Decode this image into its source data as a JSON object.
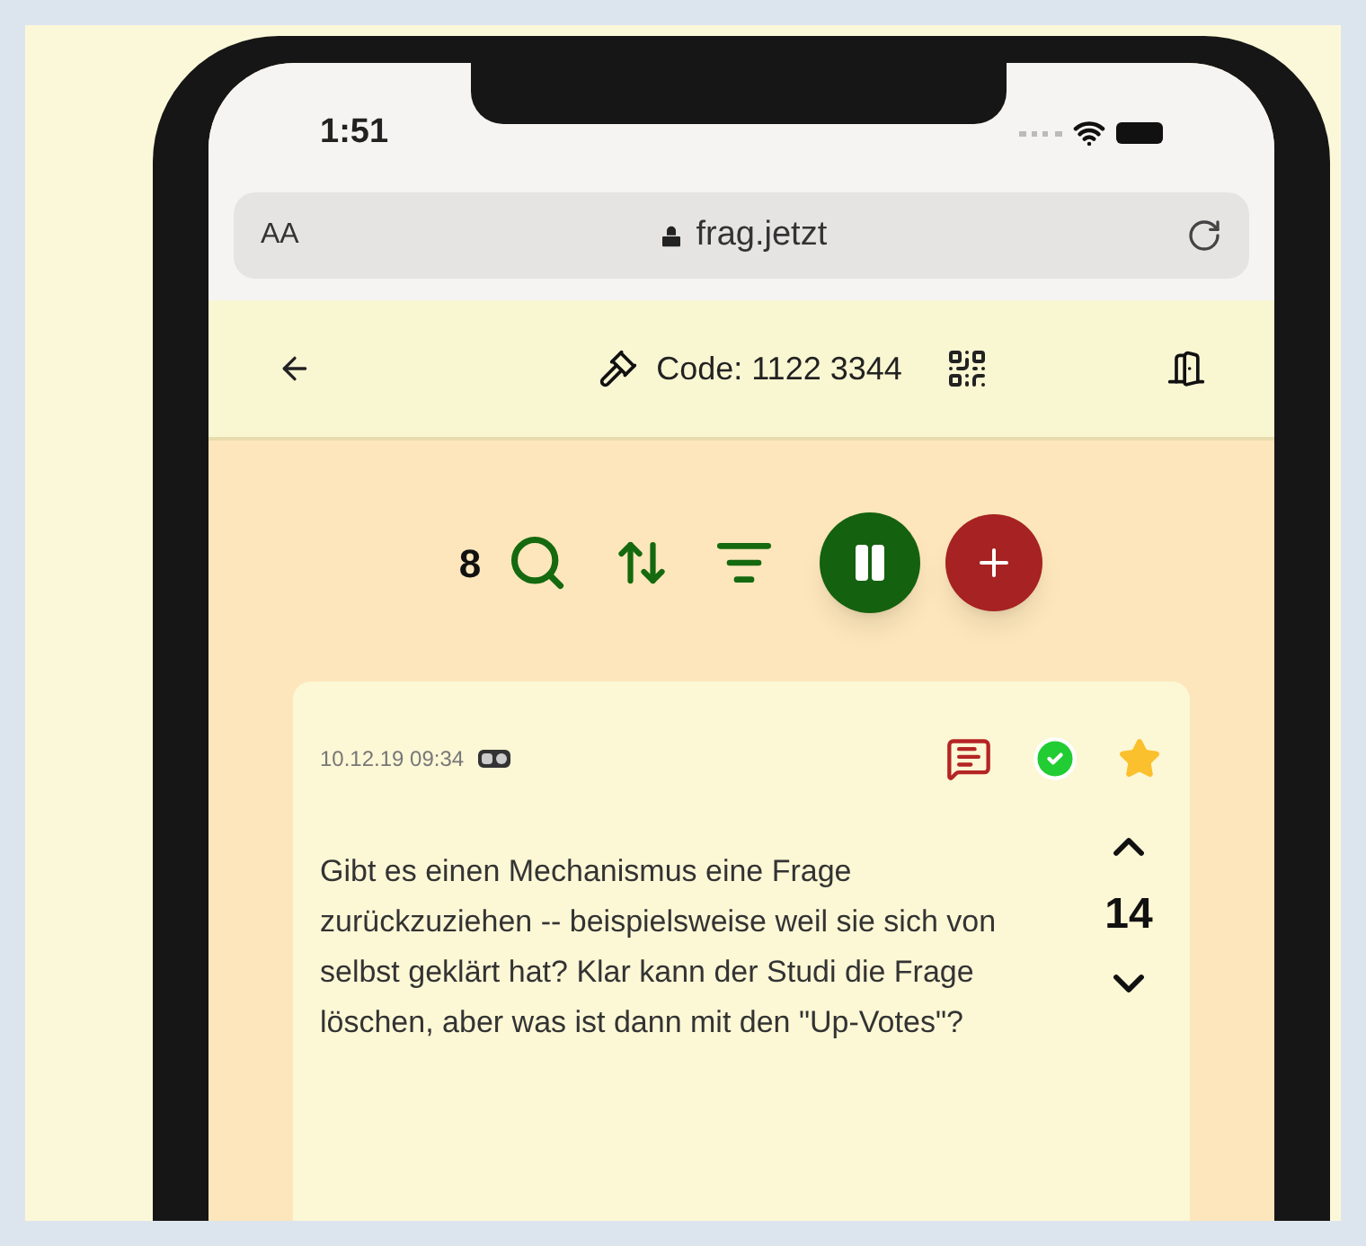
{
  "status_bar": {
    "time": "1:51"
  },
  "browser_bar": {
    "text_size": "AA",
    "url": "frag.jetzt"
  },
  "toolbar": {
    "code": "Code: 1122 3344"
  },
  "actions": {
    "count": "8",
    "paused": true
  },
  "question": {
    "timestamp": "10.12.19 09:34",
    "answered": true,
    "favorite": true,
    "text": "Gibt es einen Mechanismus eine Frage zurückzuziehen -- beispielsweise weil sie sich von selbst geklärt hat? Klar kann der Studi die Frage löschen, aber was ist dann mit den \"Up-Votes\"?",
    "votes": "14"
  }
}
